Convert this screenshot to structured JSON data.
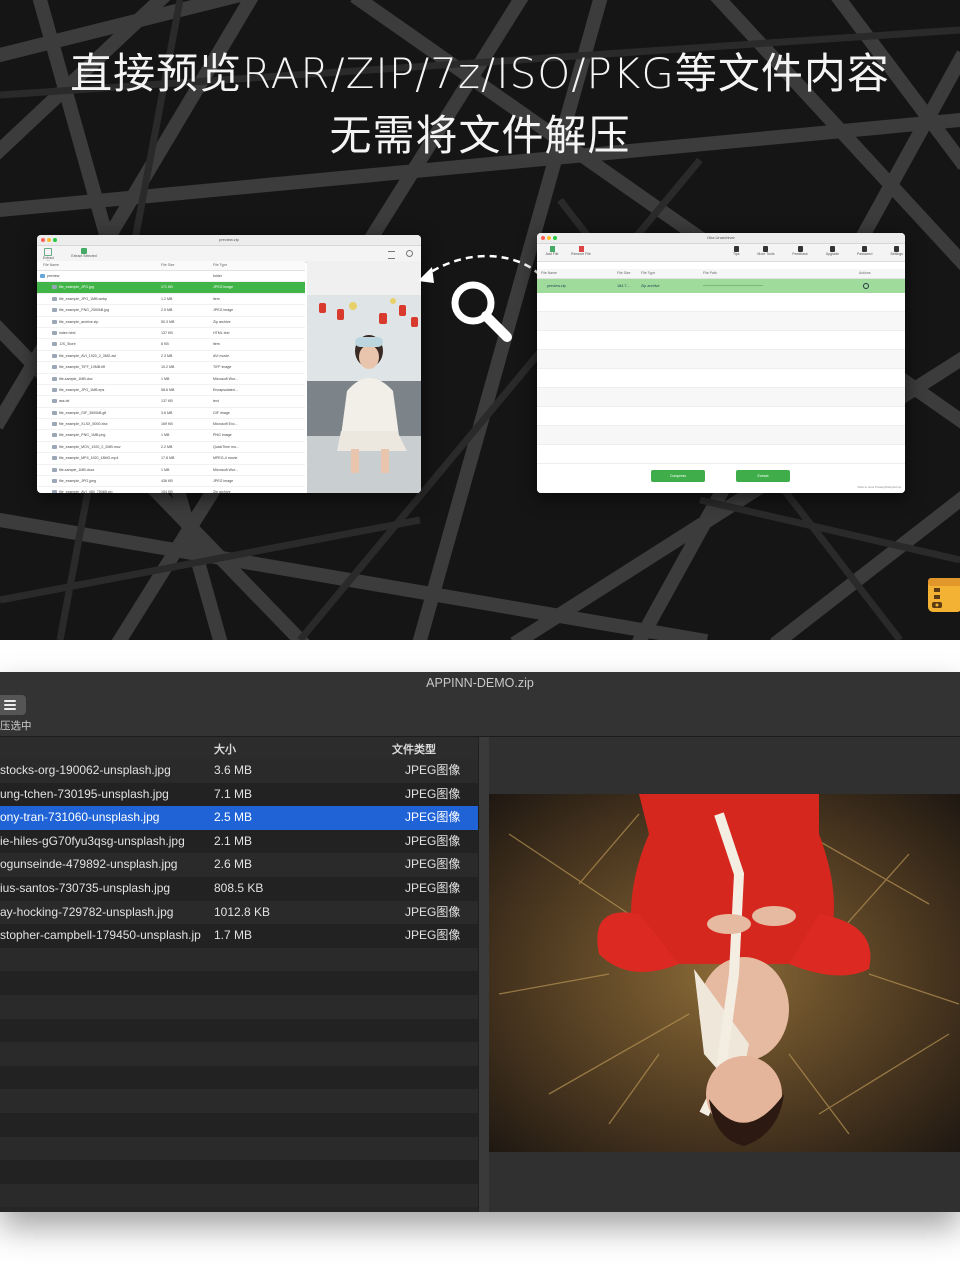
{
  "promo": {
    "headline_line1": "直接预览RAR/ZIP/7z/ISO/PKG等文件内容",
    "headline_line2": "无需将文件解压",
    "left_window": {
      "title": "preview.zip",
      "toolbar": [
        "Extract All",
        "Extract Selected"
      ],
      "columns": [
        "File Name",
        "File Size",
        "File Type"
      ],
      "rows": [
        {
          "name": "preview",
          "size": "",
          "type": "folder"
        },
        {
          "name": "file_example_JPG.jpg",
          "size": "171 KB",
          "type": "JPEG image"
        },
        {
          "name": "file_example_JPG_1MB.webp",
          "size": "1.2 MB",
          "type": "item"
        },
        {
          "name": "file_example_PNG_2500kB.jpg",
          "size": "2.5 MB",
          "type": "JPEG image"
        },
        {
          "name": "file_example_archive.zip",
          "size": "50.3 MB",
          "type": "Zip archive"
        },
        {
          "name": "index.html",
          "size": "137 KB",
          "type": "HTML text"
        },
        {
          "name": ".DS_Store",
          "size": "6 KB",
          "type": "item"
        },
        {
          "name": "file_example_AVI_1920_2_3MG.avi",
          "size": "2.3 MB",
          "type": "AVI movie"
        },
        {
          "name": "file_example_TIFF_10MB.tiff",
          "size": "10.2 MB",
          "type": "TIFF image"
        },
        {
          "name": "file-sample_1MB.doc",
          "size": "1 MB",
          "type": "Microsoft Wor..."
        },
        {
          "name": "file_example_JPG_1MB.eps",
          "size": "58.6 MB",
          "type": "Encapsulated..."
        },
        {
          "name": "ass.txt",
          "size": "137 KB",
          "type": "text"
        },
        {
          "name": "file_example_GIF_3500kB.gif",
          "size": "3.6 MB",
          "type": "GIF image"
        },
        {
          "name": "file_example_XLSX_5000.xlsx",
          "size": "169 KB",
          "type": "Microsoft Exc..."
        },
        {
          "name": "file_example_PNG_1MB.png",
          "size": "1 MB",
          "type": "PNG image"
        },
        {
          "name": "file_example_MOV_1920_2_2MB.mov",
          "size": "2.2 MB",
          "type": "QuickTime mo..."
        },
        {
          "name": "file_example_MP4_1920_18MG.mp4",
          "size": "17.8 MB",
          "type": "MPEG-4 movie"
        },
        {
          "name": "file-sample_1MB.docx",
          "size": "1 MB",
          "type": "Microsoft Wor..."
        },
        {
          "name": "file_example_JPG.jpeg",
          "size": "436 KB",
          "type": "JPEG image"
        },
        {
          "name": "file_example_AVI_480_750kB.zip",
          "size": "154 KB",
          "type": "Zip archive"
        },
        {
          "name": "file_example_PPT_1MB.ppt",
          "size": "1 MB",
          "type": "Microsoft Pow..."
        }
      ]
    },
    "right_window": {
      "title": "Oka Unarchiver",
      "toolbar_left": [
        "Add File",
        "Remove File"
      ],
      "toolbar_right": [
        "Tips",
        "More Tools",
        "Feedback",
        "Upgrade",
        "Password",
        "Settings"
      ],
      "columns": [
        "File Name",
        "File Size",
        "File Type",
        "File Path",
        "Actions"
      ],
      "row": {
        "name": "preview.zip",
        "size": "184.7...",
        "type": "Zip archive"
      },
      "compress_label": "Compress",
      "extract_label": "Extract",
      "footer": "Click to view PrivacyPolicy/terms"
    }
  },
  "app": {
    "window_title": "APPINN-DEMO.zip",
    "extract_label": "压选中",
    "columns": {
      "size": "大小",
      "type": "文件类型"
    },
    "files": [
      {
        "name": "stocks-org-190062-unsplash.jpg",
        "size": "3.6 MB",
        "type": "JPEG图像"
      },
      {
        "name": "ung-tchen-730195-unsplash.jpg",
        "size": "7.1 MB",
        "type": "JPEG图像"
      },
      {
        "name": "ony-tran-731060-unsplash.jpg",
        "size": "2.5 MB",
        "type": "JPEG图像"
      },
      {
        "name": "ie-hiles-gG70fyu3qsg-unsplash.jpg",
        "size": "2.1 MB",
        "type": "JPEG图像"
      },
      {
        "name": "ogunseinde-479892-unsplash.jpg",
        "size": "2.6 MB",
        "type": "JPEG图像"
      },
      {
        "name": "ius-santos-730735-unsplash.jpg",
        "size": "808.5 KB",
        "type": "JPEG图像"
      },
      {
        "name": "ay-hocking-729782-unsplash.jpg",
        "size": "1012.8 KB",
        "type": "JPEG图像"
      },
      {
        "name": "stopher-campbell-179450-unsplash.jp",
        "size": "1.7 MB",
        "type": "JPEG图像"
      }
    ],
    "selected_index": 2,
    "colors": {
      "selection": "#1f63d6",
      "window_bg": "#262626",
      "accent_green": "#42b549"
    }
  }
}
